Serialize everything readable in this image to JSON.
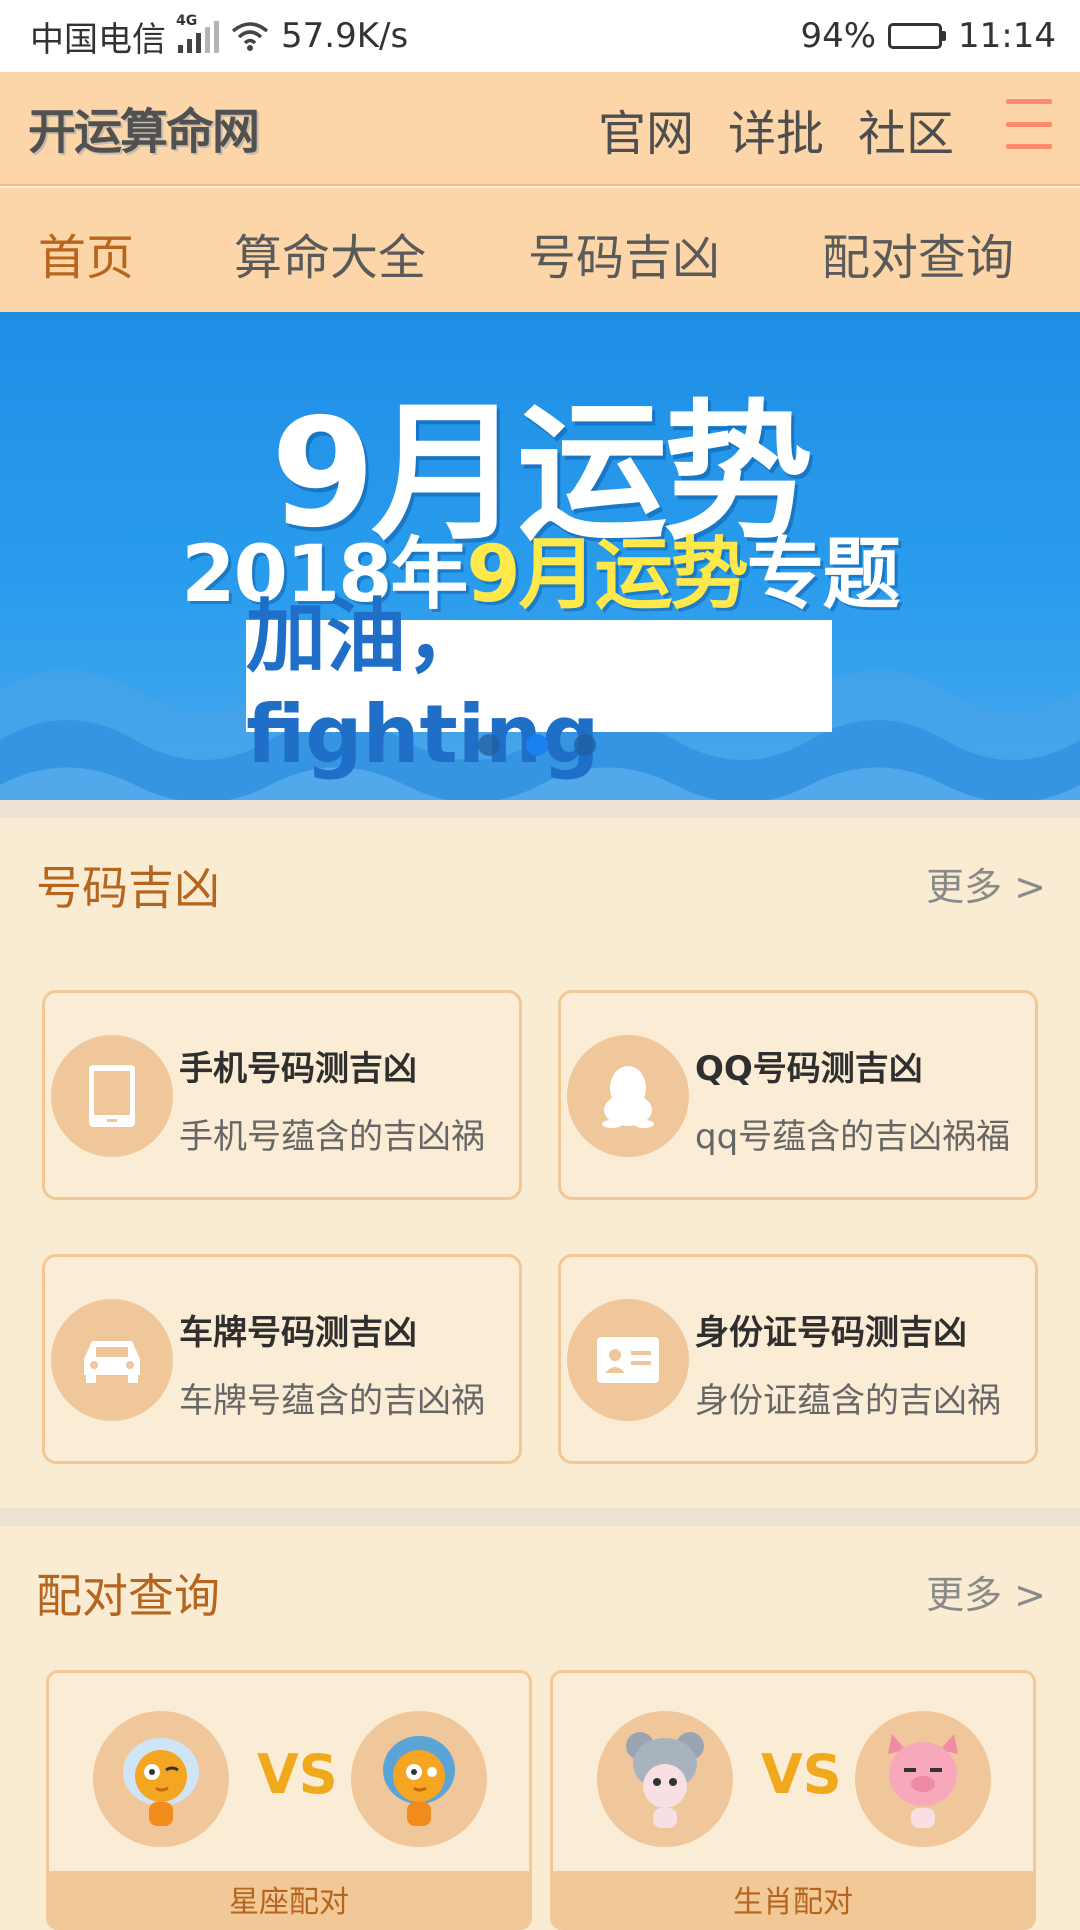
{
  "status_bar": {
    "carrier": "中国电信",
    "network": "4G",
    "speed": "57.9K/s",
    "battery": "94%",
    "time": "11:14"
  },
  "header": {
    "logo": "开运算命网",
    "links": [
      "官网",
      "详批",
      "社区"
    ]
  },
  "nav": {
    "tabs": [
      "首页",
      "算命大全",
      "号码吉凶",
      "配对查询"
    ],
    "active_index": 0
  },
  "banner": {
    "title": "9月运势",
    "subtitle_pre": "2018年",
    "subtitle_highlight": "9月运势",
    "subtitle_post": "专题",
    "box_text": "加油，fighting",
    "slide_count": 3,
    "active_slide": 1
  },
  "number_section": {
    "title": "号码吉凶",
    "more": "更多 >",
    "cards": [
      {
        "title": "手机号码测吉凶",
        "desc": "手机号蕴含的吉凶祸",
        "icon": "phone-icon"
      },
      {
        "title": "QQ号码测吉凶",
        "desc": "qq号蕴含的吉凶祸福",
        "icon": "qq-penguin-icon"
      },
      {
        "title": "车牌号码测吉凶",
        "desc": "车牌号蕴含的吉凶祸",
        "icon": "car-icon"
      },
      {
        "title": "身份证号码测吉凶",
        "desc": "身份证蕴含的吉凶祸",
        "icon": "id-card-icon"
      }
    ]
  },
  "pair_section": {
    "title": "配对查询",
    "more": "更多 >",
    "cards": [
      {
        "vs": "VS",
        "label": "星座配对"
      },
      {
        "vs": "VS",
        "label": "生肖配对"
      }
    ]
  },
  "colors": {
    "header_bg": "#fcd6a8",
    "accent": "#b5651d",
    "page_bg": "#faebd3",
    "banner_blue": "#1e8ee5",
    "vs_orange": "#f0a91c"
  }
}
